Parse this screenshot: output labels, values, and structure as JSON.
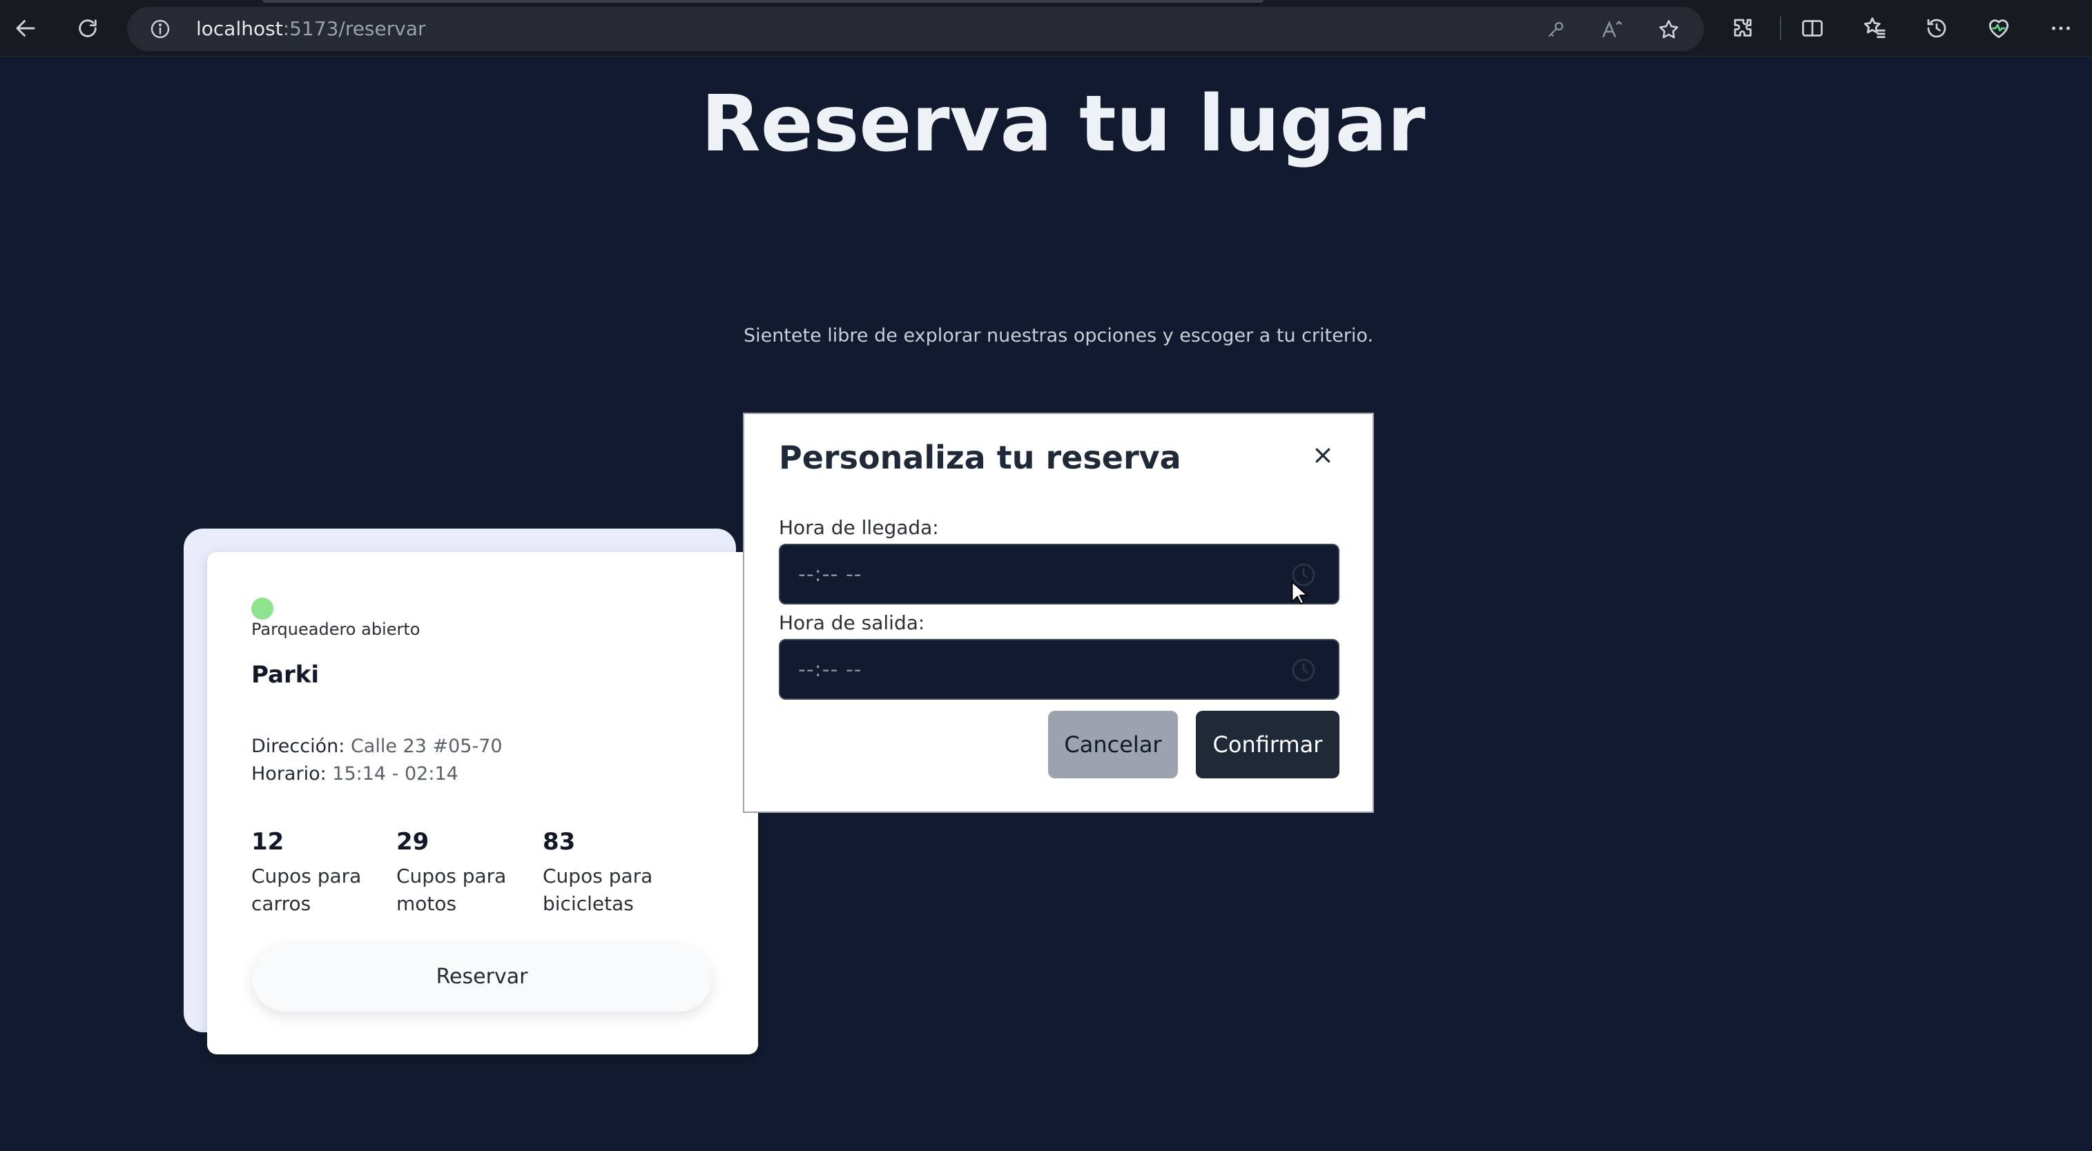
{
  "browser": {
    "url_host": "localhost",
    "url_path": ":5173/reservar"
  },
  "page": {
    "title": "Reserva tu lugar",
    "subtitle": "Sientete libre de explorar nuestras opciones y escoger a tu criterio."
  },
  "card": {
    "status": "Parqueadero abierto",
    "status_color": "#8ee38e",
    "name": "Parki",
    "address_label": "Dirección:",
    "address_value": "Calle 23 #05-70",
    "schedule_label": "Horario:",
    "schedule_value": "15:14 - 02:14",
    "stats": [
      {
        "value": "12",
        "label": "Cupos para carros"
      },
      {
        "value": "29",
        "label": "Cupos para motos"
      },
      {
        "value": "83",
        "label": "Cupos para bicicletas"
      }
    ],
    "reserve_label": "Reservar"
  },
  "modal": {
    "title": "Personaliza tu reserva",
    "arrival_label": "Hora de llegada:",
    "arrival_value": "--:-- --",
    "departure_label": "Hora de salida:",
    "departure_value": "--:-- --",
    "cancel_label": "Cancelar",
    "confirm_label": "Confirmar"
  }
}
